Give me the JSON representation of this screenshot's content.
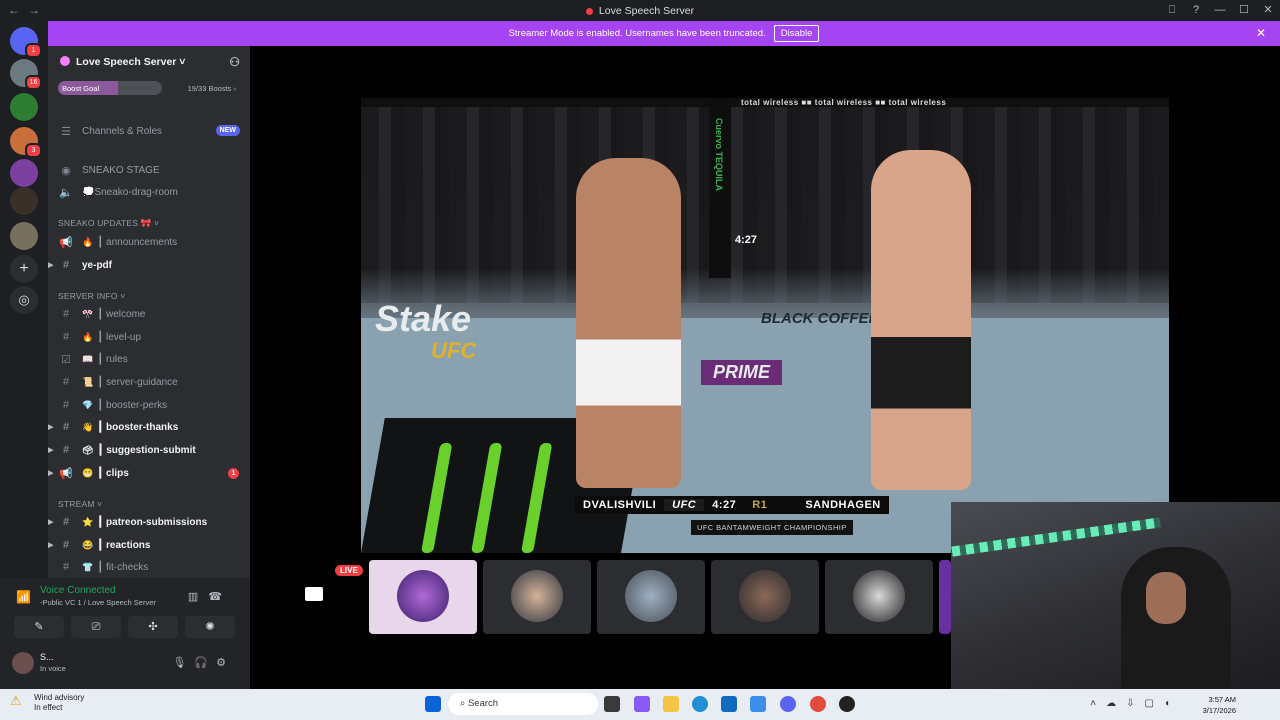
{
  "window": {
    "title": "Love Speech Server",
    "controls": [
      "⎕",
      "?",
      "—",
      "☐",
      "✕"
    ]
  },
  "banner": {
    "text": "Streamer Mode is enabled. Usernames have been truncated.",
    "disable_label": "Disable"
  },
  "rail": {
    "badges": [
      "1",
      "16",
      "3"
    ]
  },
  "server": {
    "name": "Love Speech Server ˅",
    "boost_label": "Boost Goal",
    "boost_count": "19/33 Boosts ›",
    "boost_progress": 0.58
  },
  "sidebar": {
    "channels_roles": "Channels & Roles",
    "new_badge": "NEW",
    "categories": {
      "sneako_stage": "SNEAKO STAGE",
      "sneako_updates": "SNEAKO UPDATES 🎀 ˅",
      "server_info": "SERVER INFO ˅",
      "stream": "STREAM ˅"
    },
    "items": {
      "drag_room": "💭Sneako-drag-room",
      "announcements": "┃ announcements",
      "ye_pdf": "ye-pdf",
      "welcome": "┃ welcome",
      "level_up": "┃ level-up",
      "rules": "┃ rules",
      "server_guidance": "┃ server-guidance",
      "booster_perks": "┃ booster-perks",
      "booster_thanks": "┃ booster-thanks",
      "suggestion_submit": "┃ suggestion-submit",
      "clips": "┃ clips",
      "clips_badge": "1",
      "patreon": "┃ patreon-submissions",
      "reactions": "┃ reactions",
      "fit_checks": "┃ fit-checks"
    }
  },
  "voice": {
    "status": "Voice Connected",
    "channel": "-Public VC 1 / Love Speech Server",
    "user_name": "S...",
    "user_status": "In voice"
  },
  "stream": {
    "live_label": "LIVE",
    "top_ads": "total wireless   ■■   total wireless   ■■   total wireless",
    "post_text": "Cuervo TEQUILA",
    "fight_clock": "4:27",
    "mat_brand_1": "Stake",
    "mat_brand_2": "UFC",
    "mat_brand_3": "BLACK COFFEE CO",
    "mat_brand_4": "PRIME",
    "fighter_left": "DVALISHVILI",
    "event_brand": "UFC",
    "round_clock": "4:27",
    "round": "R1",
    "fighter_right": "SANDHAGEN",
    "subtitle": "UFC BANTAMWEIGHT CHAMPIONSHIP"
  },
  "taskbar": {
    "weather_title": "Wind advisory",
    "weather_sub": "In effect",
    "search_placeholder": "Search",
    "time": "3:57 AM",
    "date": "3/17/2026"
  },
  "colors": {
    "banner": "#a544f2",
    "accent": "#5865f2",
    "online": "#23a55a",
    "danger": "#f23f43"
  }
}
